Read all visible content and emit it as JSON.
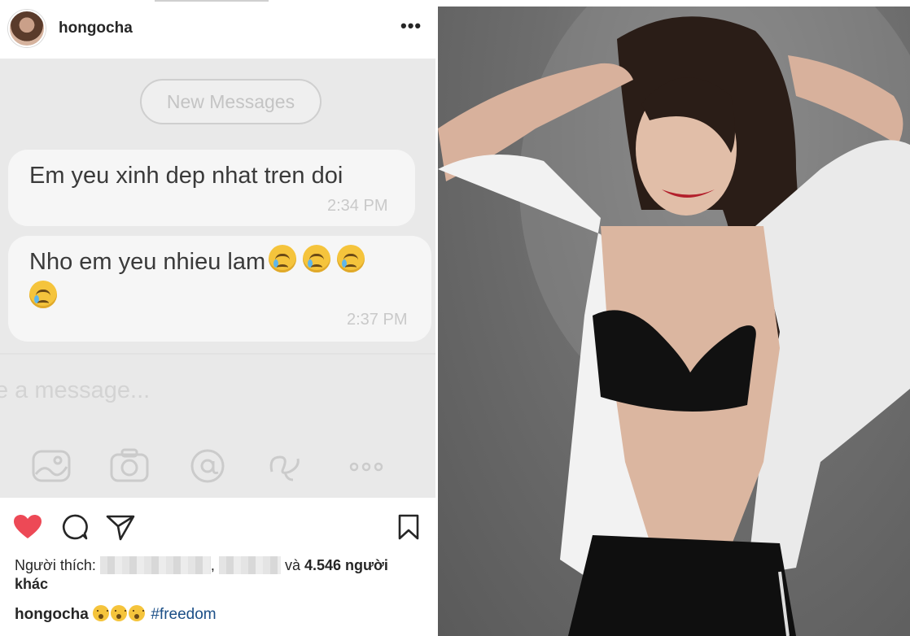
{
  "post": {
    "username": "hongocha",
    "more_icon": "more-horizontal-icon"
  },
  "screenshot": {
    "new_messages_label": "New Messages",
    "messages": [
      {
        "text": "Em yeu xinh dep nhat tren doi",
        "time": "2:34 PM"
      },
      {
        "text": "Nho em yeu nhieu lam",
        "time": "2:37 PM",
        "emoji_count": 4
      }
    ],
    "input_placeholder": "e a message...",
    "tools": [
      "image-icon",
      "camera-icon",
      "at-icon",
      "sticker-icon",
      "more-icon"
    ]
  },
  "actions": {
    "like_icon": "heart-icon",
    "comment_icon": "comment-icon",
    "share_icon": "send-icon",
    "save_icon": "bookmark-icon"
  },
  "likes": {
    "prefix": "Người thích:",
    "separator": ",",
    "and_label": "và",
    "count_label": "4.546 người",
    "suffix": "khác"
  },
  "caption": {
    "username": "hongocha",
    "hashtag": "#freedom"
  },
  "colors": {
    "heart": "#ed4956",
    "hashtag": "#1b4f87",
    "screenshot_bg": "#e9e9e9"
  }
}
